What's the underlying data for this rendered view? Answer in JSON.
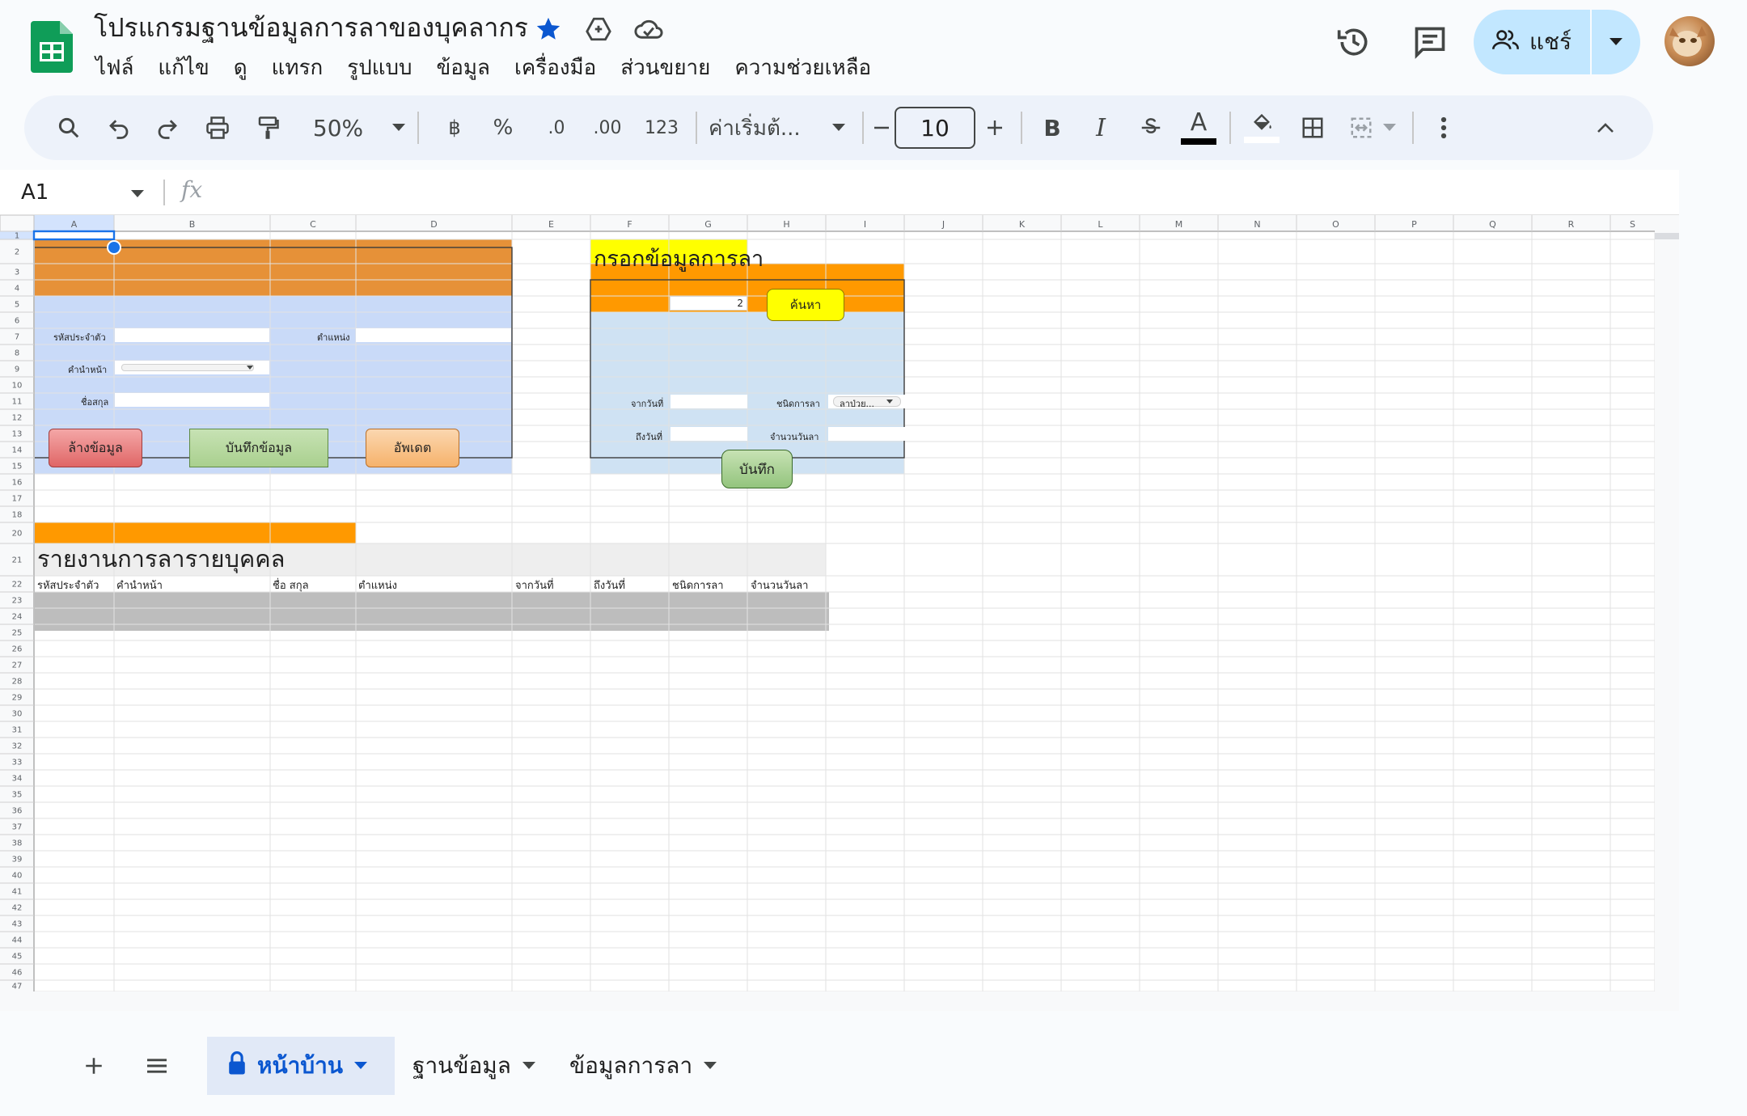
{
  "app": {
    "doc_title": "โปรแกรมฐานข้อมูลการลาของบุคลากร",
    "menu": [
      "ไฟล์",
      "แก้ไข",
      "ดู",
      "แทรก",
      "รูปแบบ",
      "ข้อมูล",
      "เครื่องมือ",
      "ส่วนขยาย",
      "ความช่วยเหลือ"
    ],
    "share_label": "แชร์"
  },
  "toolbar": {
    "zoom": "50%",
    "currency_symbol": "฿",
    "percent_symbol": "%",
    "decrease_decimal": ".0",
    "increase_decimal": ".00",
    "number_format": "123",
    "font_name": "ค่าเริ่มต้...",
    "font_size": "10",
    "bold": "B",
    "italic": "I",
    "text_color_letter": "A"
  },
  "formula_bar": {
    "cell_ref": "A1",
    "fx": "fx"
  },
  "grid": {
    "columns": [
      "A",
      "B",
      "C",
      "D",
      "E",
      "F",
      "G",
      "H",
      "I",
      "J",
      "K",
      "L",
      "M",
      "N",
      "O",
      "P",
      "Q",
      "R",
      "S"
    ],
    "rows": [
      "1",
      "2",
      "3",
      "4",
      "5",
      "6",
      "7",
      "8",
      "9",
      "10",
      "11",
      "12",
      "13",
      "14",
      "15",
      "16",
      "17",
      "18",
      "20",
      "21",
      "22",
      "23",
      "24",
      "25",
      "26",
      "27",
      "28",
      "29",
      "30",
      "31",
      "32",
      "33",
      "34",
      "35",
      "36",
      "37",
      "38",
      "39",
      "40",
      "41",
      "42",
      "43",
      "44",
      "45",
      "46",
      "47"
    ]
  },
  "personnel_form": {
    "id_label": "รหัสประจำตัว",
    "position_label": "ตำแหน่ง",
    "prefix_label": "คำนำหน้า",
    "name_label": "ชื่อสกุล",
    "clear_button": "ล้างข้อมูล",
    "save_button": "บันทึกข้อมูล",
    "update_button": "อัพเดต"
  },
  "leave_form": {
    "title": "กรอกข้อมูลการลา",
    "search_value": "2",
    "search_button": "ค้นหา",
    "from_date_label": "จากวันที่",
    "leave_type_label": "ชนิดการลา",
    "leave_type_value": "ลาป่วย...",
    "to_date_label": "ถึงวันที่",
    "leave_days_label": "จำนวนวันลา",
    "save_button": "บันทึก"
  },
  "report": {
    "title": "รายงานการลารายบุคคล",
    "columns": [
      "รหัสประจำตัว",
      "คำนำหน้า",
      "ชื่อ สกุล",
      "ตำแหน่ง",
      "จากวันที่",
      "ถึงวันที่",
      "ชนิดการลา",
      "จำนวนวันลา"
    ]
  },
  "sheets": {
    "tabs": [
      "หน้าบ้าน",
      "ฐานข้อมูล",
      "ข้อมูลการลา"
    ],
    "active_index": 0
  },
  "colors": {
    "header_orange": "#e69138",
    "form_blue": "#c9daf8",
    "leave_blue": "#cfe2f3",
    "leave_orange": "#ff9900",
    "title_yellow": "#ffff00",
    "button_red": "#e06666",
    "button_green": "#a9d08e",
    "button_orange": "#f6b26b",
    "report_gray": "#bdbdbd",
    "accent_blue": "#0b57d0",
    "share_blue": "#c2e7ff"
  },
  "icons": [
    "sheets-logo-icon",
    "star-icon",
    "move-to-drive-icon",
    "cloud-saved-icon",
    "history-icon",
    "comment-icon",
    "people-icon",
    "search-icon",
    "undo-icon",
    "redo-icon",
    "print-icon",
    "paint-format-icon",
    "bold-icon",
    "italic-icon",
    "strikethrough-icon",
    "text-color-icon",
    "fill-color-icon",
    "borders-icon",
    "merge-cells-icon",
    "more-vert-icon",
    "collapse-icon",
    "add-sheet-icon",
    "all-sheets-icon",
    "lock-icon"
  ]
}
